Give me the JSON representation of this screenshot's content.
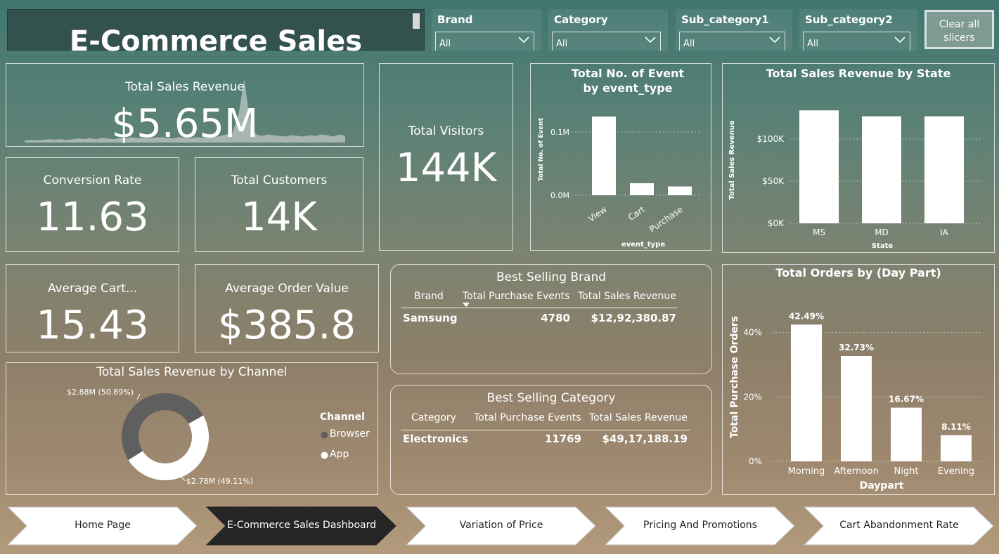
{
  "header": {
    "title": "E-Commerce Sales"
  },
  "slicers": [
    {
      "label": "Brand",
      "value": "All"
    },
    {
      "label": "Category",
      "value": "All"
    },
    {
      "label": "Sub_category1",
      "value": "All"
    },
    {
      "label": "Sub_category2",
      "value": "All"
    }
  ],
  "clear_slicers_line1": "Clear all",
  "clear_slicers_line2": "slicers",
  "kpis": {
    "revenue": {
      "label": "Total Sales Revenue",
      "value": "$5.65M"
    },
    "visitors": {
      "label": "Total Visitors",
      "value": "144K"
    },
    "conversion": {
      "label": "Conversion Rate",
      "value": "11.63"
    },
    "customers": {
      "label": "Total Customers",
      "value": "14K"
    },
    "avg_cart": {
      "label": "Average Cart...",
      "value": "15.43"
    },
    "aov": {
      "label": "Average Order Value",
      "value": "$385.8"
    }
  },
  "best_brand": {
    "title": "Best Selling Brand",
    "headers": [
      "Brand",
      "Total Purchase Events",
      "Total Sales Revenue"
    ],
    "row": [
      "Samsung",
      "4780",
      "$12,92,380.87"
    ]
  },
  "best_category": {
    "title": "Best Selling Category",
    "headers": [
      "Category",
      "Total Purchase Events",
      "Total Sales Revenue"
    ],
    "row": [
      "Electronics",
      "11769",
      "$49,17,188.19"
    ]
  },
  "chart_data": [
    {
      "type": "area",
      "title": "",
      "note": "sparkline behind Total Sales Revenue KPI",
      "values": [
        3,
        4,
        3.5,
        4,
        5,
        4.5,
        5,
        4,
        5,
        6,
        5,
        6.5,
        5,
        7,
        6,
        5,
        7,
        6,
        8,
        6.5,
        7,
        6,
        7.5,
        8,
        7,
        6,
        8,
        7,
        6,
        8,
        7,
        9,
        8,
        10,
        12,
        15,
        40,
        95,
        30,
        12,
        10,
        12,
        11,
        10,
        9,
        11,
        10,
        9,
        11,
        10,
        12,
        11,
        9,
        12,
        10
      ]
    },
    {
      "type": "bar",
      "title": "Total No. of Event by event_type",
      "categories": [
        "View",
        "Cart",
        "Purchase"
      ],
      "values": [
        0.1245,
        0.019,
        0.0138
      ],
      "xlabel": "event_type",
      "ylabel": "Total No. of Event",
      "yticks": [
        "0.0M",
        "0.1M"
      ],
      "ylim": [
        0,
        0.15
      ]
    },
    {
      "type": "bar",
      "title": "Total Sales Revenue by State",
      "categories": [
        "MS",
        "MD",
        "IA"
      ],
      "values": [
        134000,
        127000,
        127000
      ],
      "xlabel": "State",
      "ylabel": "Total Sales Revenue",
      "yticks": [
        "$0K",
        "$50K",
        "$100K"
      ],
      "ylim": [
        0,
        150000
      ]
    },
    {
      "type": "pie",
      "title": "Total Sales Revenue by Channel",
      "legend_title": "Channel",
      "labels": [
        "Browser",
        "App"
      ],
      "values": [
        2.88,
        2.78
      ],
      "data_labels": [
        "$2.88M (50.89%)",
        "$2.78M (49.11%)"
      ],
      "colors": [
        "#5f5f5f",
        "#ffffff"
      ]
    },
    {
      "type": "bar",
      "title": "Total Orders by (Day Part)",
      "categories": [
        "Morning",
        "Afternoon",
        "Night",
        "Evening"
      ],
      "values": [
        42.49,
        32.73,
        16.67,
        8.11
      ],
      "data_labels": [
        "42.49%",
        "32.73%",
        "16.67%",
        "8.11%"
      ],
      "xlabel": "Daypart",
      "ylabel": "Total Purchase Orders",
      "yticks": [
        "0%",
        "20%",
        "40%"
      ],
      "ylim": [
        0,
        48
      ]
    }
  ],
  "nav": {
    "items": [
      {
        "label": "Home Page",
        "active": false
      },
      {
        "label": "E-Commerce Sales Dashboard",
        "active": true
      },
      {
        "label": "Variation of Price",
        "active": false
      },
      {
        "label": "Pricing And Promotions",
        "active": false
      },
      {
        "label": "Cart Abandonment Rate",
        "active": false
      }
    ]
  },
  "colors": {
    "bar": "#ffffff",
    "nav_active": "#252525",
    "nav_inactive": "#ffffff",
    "banner": "#34524d"
  }
}
